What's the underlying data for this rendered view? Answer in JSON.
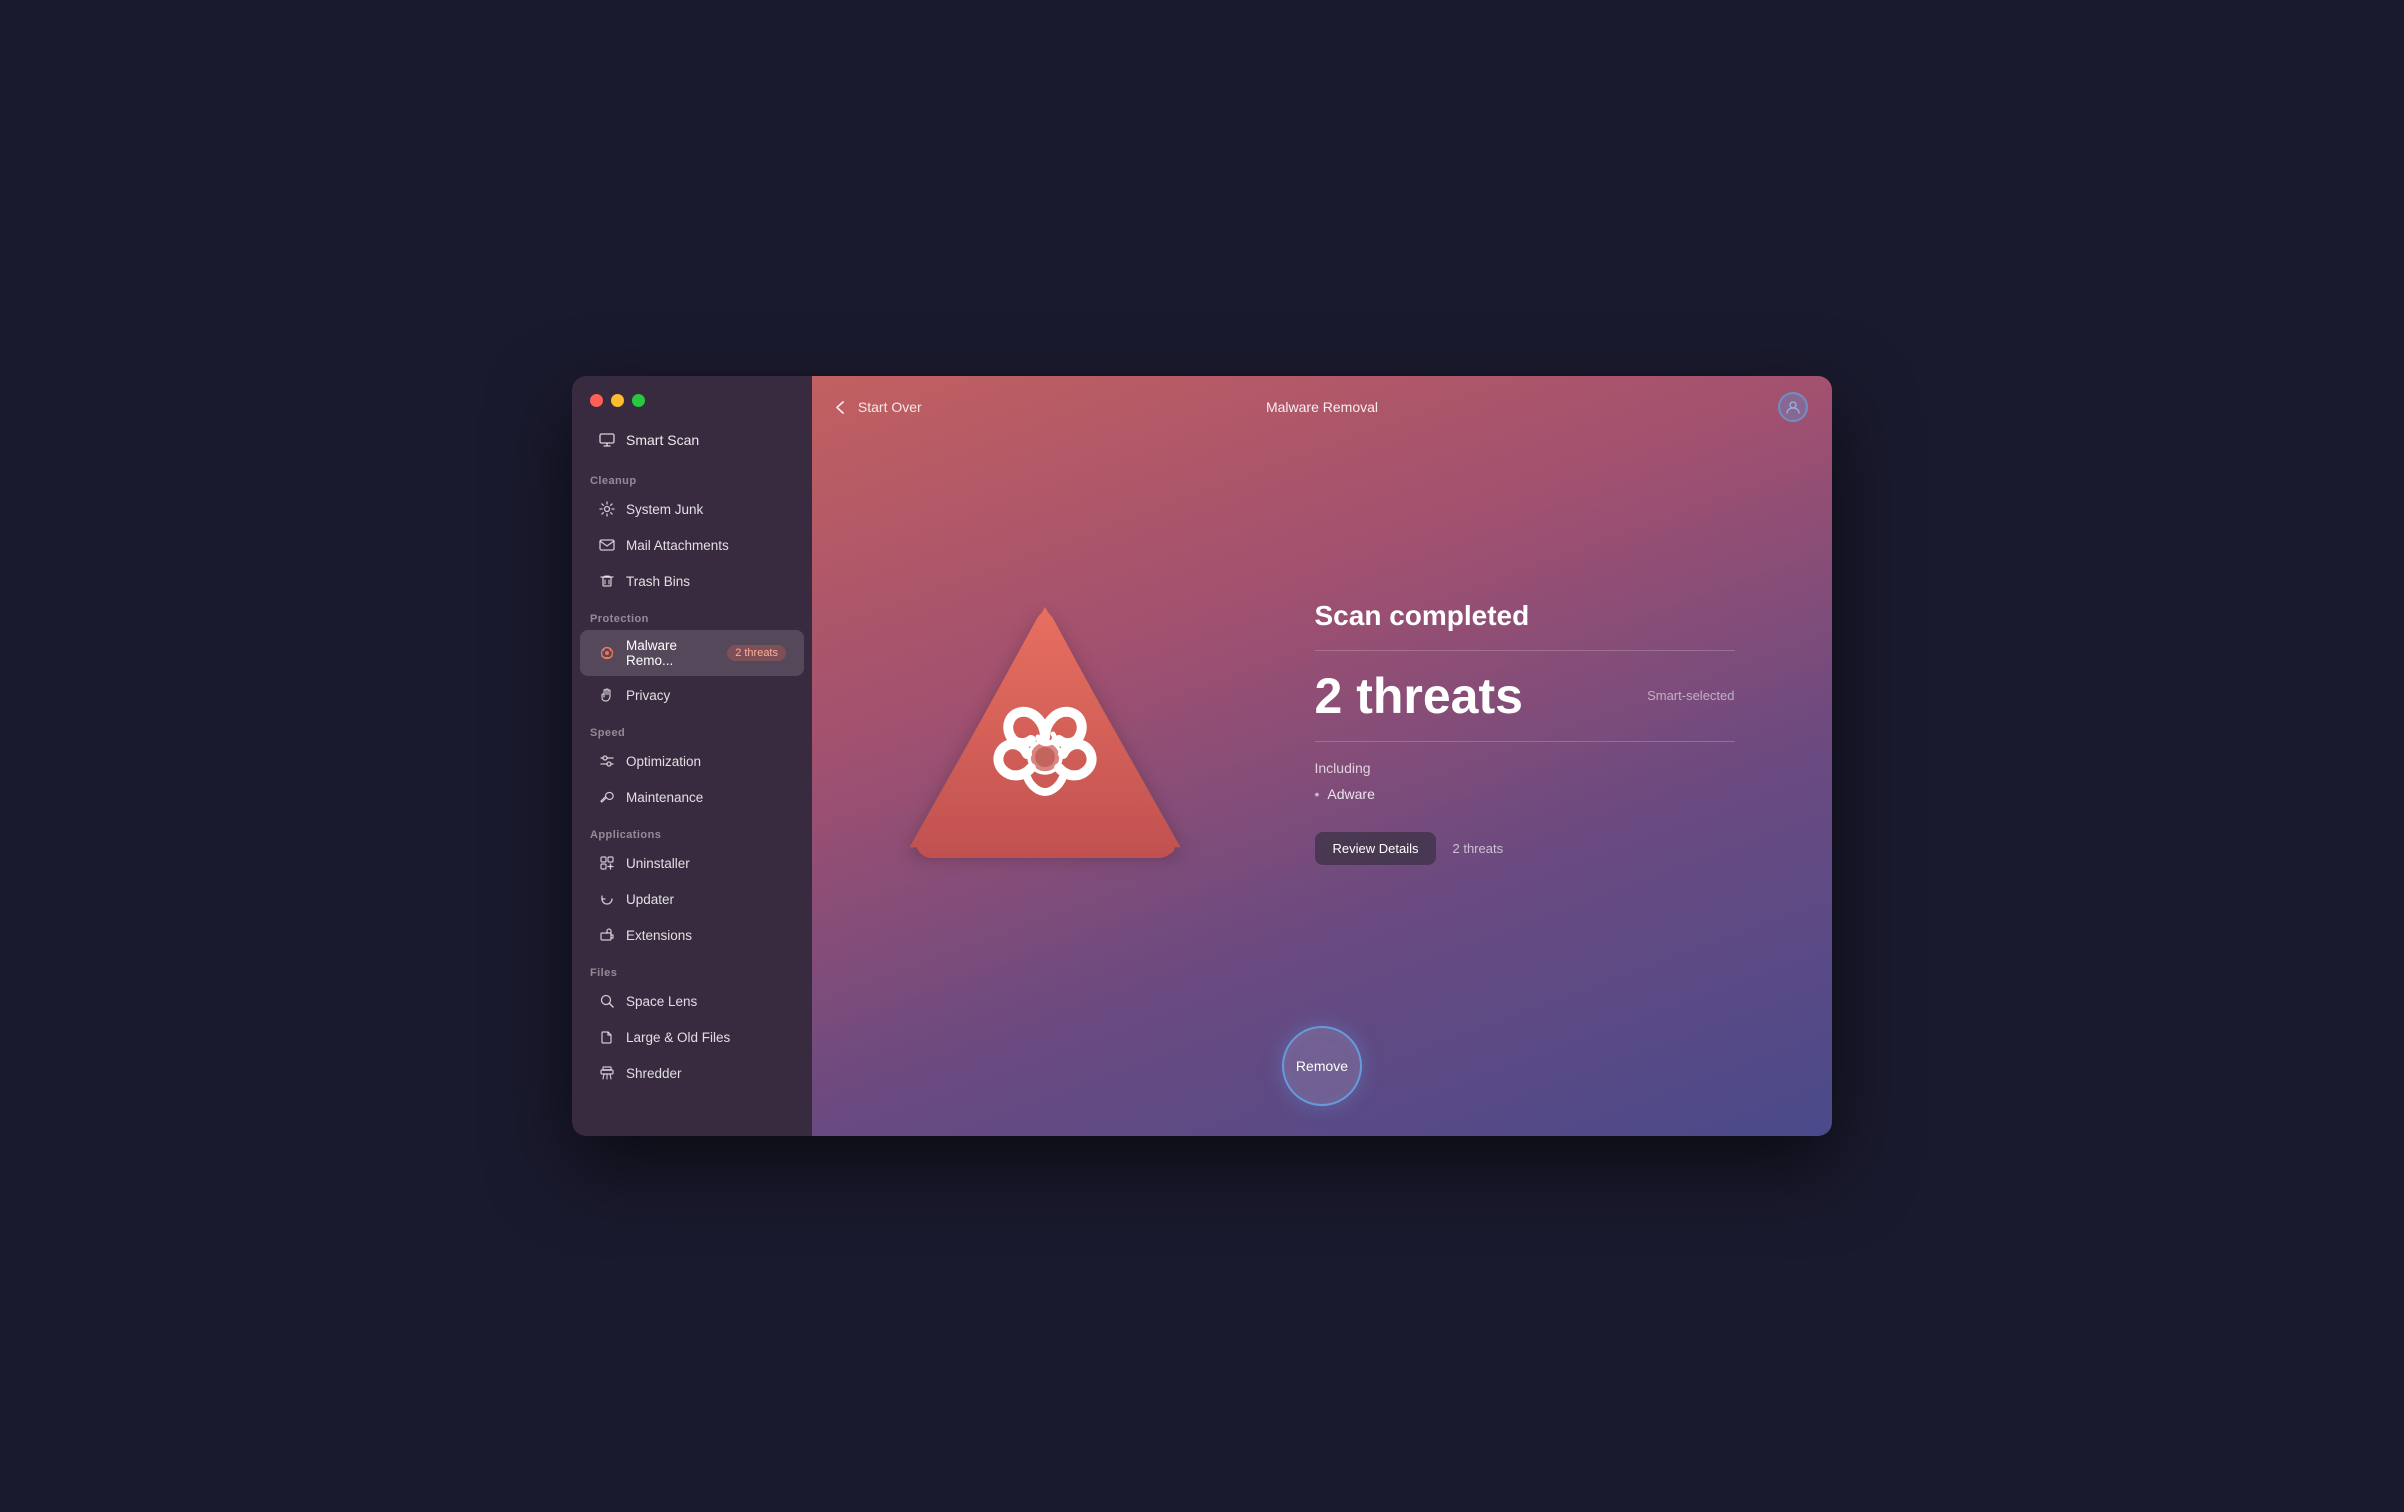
{
  "window": {
    "title": "Malware Removal"
  },
  "traffic_lights": {
    "red": "close",
    "yellow": "minimize",
    "green": "maximize"
  },
  "header": {
    "back_label": "Start Over",
    "title": "Malware Removal"
  },
  "sidebar": {
    "top_item": {
      "label": "Smart Scan",
      "icon": "monitor-icon"
    },
    "sections": [
      {
        "label": "Cleanup",
        "items": [
          {
            "id": "system-junk",
            "label": "System Junk",
            "icon": "gear-icon"
          },
          {
            "id": "mail-attachments",
            "label": "Mail Attachments",
            "icon": "mail-icon"
          },
          {
            "id": "trash-bins",
            "label": "Trash Bins",
            "icon": "trash-icon"
          }
        ]
      },
      {
        "label": "Protection",
        "items": [
          {
            "id": "malware-removal",
            "label": "Malware Remo...",
            "icon": "biohazard-icon",
            "active": true,
            "badge": "2 threats"
          },
          {
            "id": "privacy",
            "label": "Privacy",
            "icon": "hand-icon"
          }
        ]
      },
      {
        "label": "Speed",
        "items": [
          {
            "id": "optimization",
            "label": "Optimization",
            "icon": "sliders-icon"
          },
          {
            "id": "maintenance",
            "label": "Maintenance",
            "icon": "wrench-icon"
          }
        ]
      },
      {
        "label": "Applications",
        "items": [
          {
            "id": "uninstaller",
            "label": "Uninstaller",
            "icon": "uninstaller-icon"
          },
          {
            "id": "updater",
            "label": "Updater",
            "icon": "updater-icon"
          },
          {
            "id": "extensions",
            "label": "Extensions",
            "icon": "extensions-icon"
          }
        ]
      },
      {
        "label": "Files",
        "items": [
          {
            "id": "space-lens",
            "label": "Space Lens",
            "icon": "lens-icon"
          },
          {
            "id": "large-old-files",
            "label": "Large & Old Files",
            "icon": "files-icon"
          },
          {
            "id": "shredder",
            "label": "Shredder",
            "icon": "shredder-icon"
          }
        ]
      }
    ]
  },
  "main": {
    "scan_completed_label": "Scan completed",
    "threats_count": "2 threats",
    "threats_number": "2",
    "threats_label": "threats",
    "smart_selected_label": "Smart-selected",
    "including_label": "Including",
    "threat_items": [
      "Adware"
    ],
    "review_button_label": "Review Details",
    "review_threats_label": "2 threats",
    "remove_button_label": "Remove"
  }
}
